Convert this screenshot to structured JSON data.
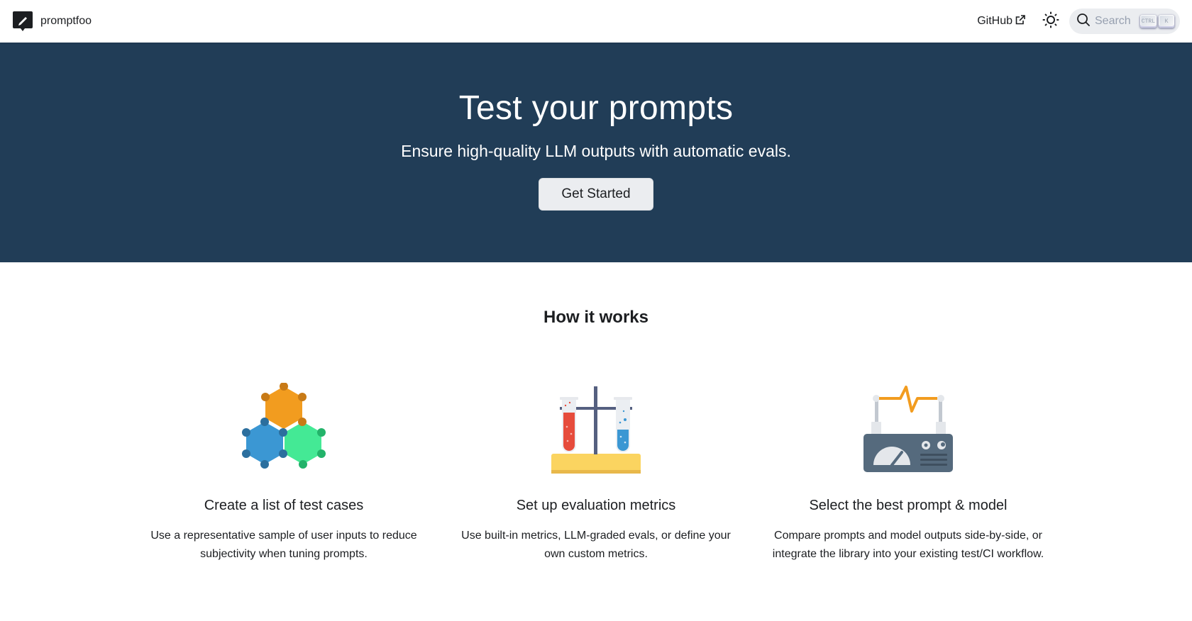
{
  "navbar": {
    "brand": "promptfoo",
    "github_label": "GitHub",
    "search_placeholder": "Search",
    "search_keys": [
      "CTRL",
      "K"
    ]
  },
  "hero": {
    "title": "Test your prompts",
    "subtitle": "Ensure high-quality LLM outputs with automatic evals.",
    "cta_label": "Get Started",
    "background": "#213d57"
  },
  "how_it_works": {
    "title": "How it works",
    "features": [
      {
        "icon": "hexagon-molecule-icon",
        "title": "Create a list of test cases",
        "description": "Use a representative sample of user inputs to reduce subjectivity when tuning prompts."
      },
      {
        "icon": "test-tubes-icon",
        "title": "Set up evaluation metrics",
        "description": "Use built-in metrics, LLM-graded evals, or define your own custom metrics."
      },
      {
        "icon": "meter-device-icon",
        "title": "Select the best prompt & model",
        "description": "Compare prompts and model outputs side-by-side, or integrate the library into your existing test/CI workflow."
      }
    ]
  }
}
